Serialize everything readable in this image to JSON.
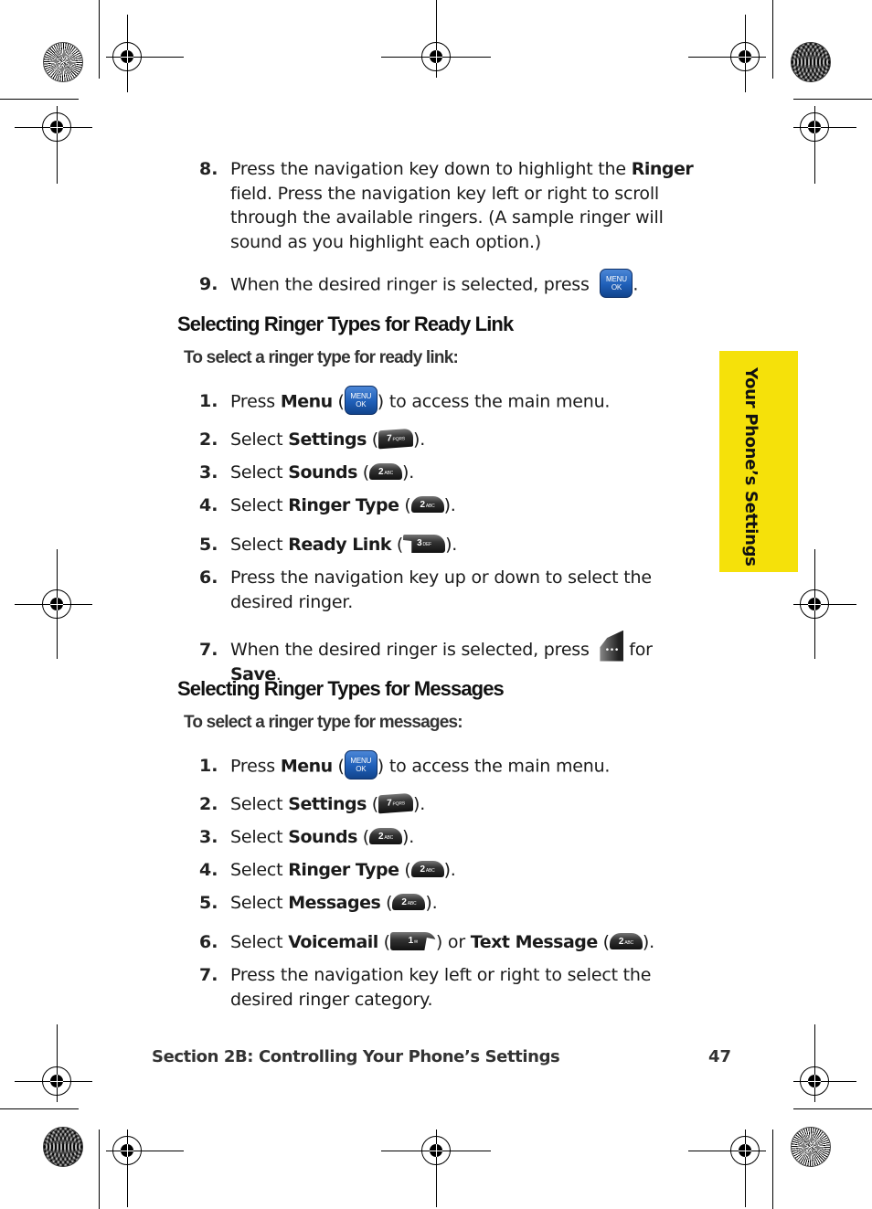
{
  "side_tab": {
    "label": "Your Phone’s Settings",
    "color": "#f5e10a"
  },
  "intro_steps": [
    {
      "num": "8.",
      "parts": [
        "Press the navigation key down to highlight the ",
        "Ringer",
        " field. Press the navigation key left or right to scroll through the available ringers. (A sample ringer will sound as you highlight each option.)"
      ]
    },
    {
      "num": "9.",
      "text": "When the desired ringer is selected, press",
      "key": "menu-ok",
      "suffix": "."
    }
  ],
  "section_ready_link": {
    "heading": "Selecting Ringer Types for Ready Link",
    "subheading": "To select a ringer type for ready link:",
    "steps": [
      {
        "num": "1.",
        "pre": "Press ",
        "bold": "Menu",
        "key": "menu-ok",
        "post": " to access the main menu."
      },
      {
        "num": "2.",
        "pre": "Select ",
        "bold": "Settings",
        "key": "7 PQRS"
      },
      {
        "num": "3.",
        "pre": "Select ",
        "bold": "Sounds",
        "key": "2 ABC"
      },
      {
        "num": "4.",
        "pre": "Select ",
        "bold": "Ringer Type",
        "key": "2 ABC"
      },
      {
        "num": "5.",
        "pre": "Select ",
        "bold": "Ready Link",
        "key": "3 DEF"
      },
      {
        "num": "6.",
        "text": "Press the navigation key up or down to select the desired ringer."
      },
      {
        "num": "7.",
        "pre": "When the desired ringer is selected, press",
        "key": "softkey",
        "mid": " for ",
        "bold": "Save",
        "post": "."
      }
    ]
  },
  "section_messages": {
    "heading": "Selecting Ringer Types for Messages",
    "subheading": "To select a ringer type for messages:",
    "steps": [
      {
        "num": "1.",
        "pre": "Press ",
        "bold": "Menu",
        "key": "menu-ok",
        "post": " to access the main menu."
      },
      {
        "num": "2.",
        "pre": "Select ",
        "bold": "Settings",
        "key": "7 PQRS"
      },
      {
        "num": "3.",
        "pre": "Select ",
        "bold": "Sounds",
        "key": "2 ABC"
      },
      {
        "num": "4.",
        "pre": "Select ",
        "bold": "Ringer Type",
        "key": "2 ABC"
      },
      {
        "num": "5.",
        "pre": "Select ",
        "bold": "Messages",
        "key": "2 ABC"
      },
      {
        "num": "6.",
        "pre": "Select ",
        "bold": "Voicemail",
        "key": "1 voicemail",
        "mid": " or ",
        "bold2": "Text Message",
        "key2": "2 ABC"
      },
      {
        "num": "7.",
        "text": "Press the navigation key left or right to select the desired ringer category."
      }
    ]
  },
  "keys": {
    "menu_top": "MENU",
    "menu_bottom": "OK",
    "k7": "7",
    "k7_sub": "PQRS",
    "k2": "2",
    "k2_sub": "ABC",
    "k3": "3",
    "k3_sub": "DEF",
    "k1": "1",
    "k1_sub": "✉",
    "soft": "•••"
  },
  "punct": {
    "open": " (",
    "close": ").",
    "close_only": ")"
  },
  "footer": {
    "section": "Section 2B: Controlling Your Phone’s Settings",
    "page": "47"
  }
}
